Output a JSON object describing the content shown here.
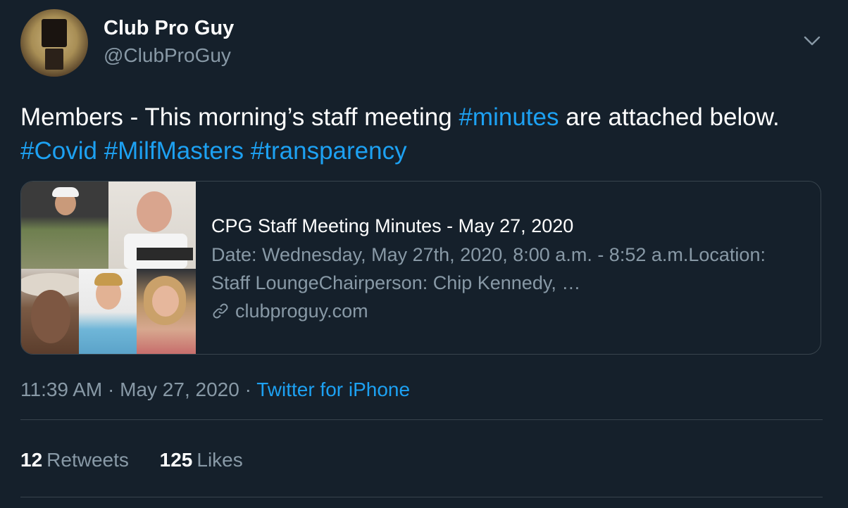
{
  "author": {
    "display_name": "Club Pro Guy",
    "handle": "@ClubProGuy"
  },
  "tweet": {
    "text_part1": "Members - This morning’s staff  meeting ",
    "hashtag1": "#minutes",
    "text_part2": " are attached below. ",
    "hashtag2": "#Covid",
    "hashtag3": "#MilfMasters",
    "hashtag4": "#transparency"
  },
  "card": {
    "title": "CPG Staff Meeting Minutes - May 27, 2020",
    "description": "Date: Wednesday, May 27th, 2020, 8:00 a.m. - 8:52 a.m.Location: Staff LoungeChairperson: Chip Kennedy, …",
    "domain": "clubproguy.com",
    "image_icon": "collage-photo"
  },
  "meta": {
    "time": "11:39 AM",
    "separator": "·",
    "date": "May 27, 2020",
    "source": "Twitter for iPhone"
  },
  "stats": {
    "retweets_count": "12",
    "retweets_label": "Retweets",
    "likes_count": "125",
    "likes_label": "Likes"
  },
  "icons": {
    "menu": "chevron-down-icon",
    "link": "link-icon"
  },
  "colors": {
    "background": "#15202b",
    "accent": "#1da1f2",
    "secondary_text": "#8899a6",
    "border": "#38444d"
  }
}
